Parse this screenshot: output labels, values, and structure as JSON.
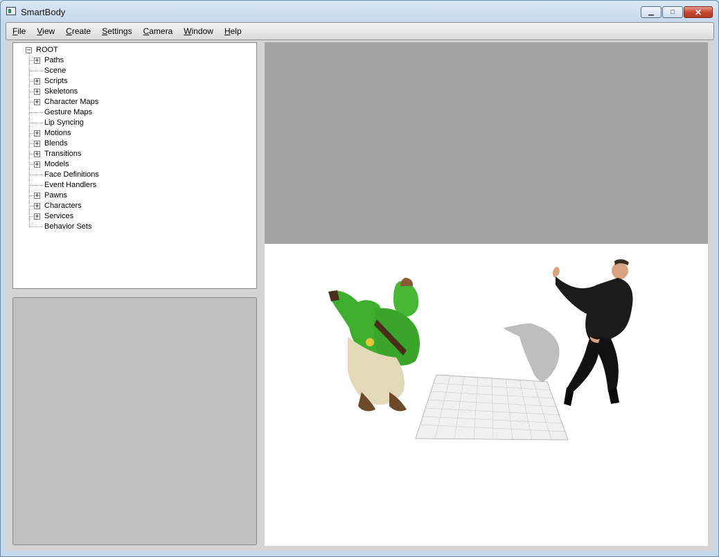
{
  "window": {
    "title": "SmartBody",
    "controls": {
      "minimize": "▁",
      "maximize": "□",
      "close": "✕"
    }
  },
  "menubar": {
    "items": [
      "File",
      "View",
      "Create",
      "Settings",
      "Camera",
      "Window",
      "Help"
    ]
  },
  "tree": {
    "root": {
      "label": "ROOT",
      "expanded": true
    },
    "items": [
      {
        "label": "Paths",
        "expandable": true
      },
      {
        "label": "Scene",
        "expandable": false
      },
      {
        "label": "Scripts",
        "expandable": true
      },
      {
        "label": "Skeletons",
        "expandable": true
      },
      {
        "label": "Character Maps",
        "expandable": true
      },
      {
        "label": "Gesture Maps",
        "expandable": false
      },
      {
        "label": "Lip Syncing",
        "expandable": false
      },
      {
        "label": "Motions",
        "expandable": true
      },
      {
        "label": "Blends",
        "expandable": true
      },
      {
        "label": "Transitions",
        "expandable": true
      },
      {
        "label": "Models",
        "expandable": true
      },
      {
        "label": "Face Definitions",
        "expandable": false
      },
      {
        "label": "Event Handlers",
        "expandable": false
      },
      {
        "label": "Pawns",
        "expandable": true
      },
      {
        "label": "Characters",
        "expandable": true
      },
      {
        "label": "Services",
        "expandable": true
      },
      {
        "label": "Behavior Sets",
        "expandable": false
      }
    ]
  },
  "viewport": {
    "characters": [
      {
        "name": "orc-character",
        "colors": {
          "skin": "#3fae2e",
          "pants": "#e3d8b8",
          "boots": "#6b4a2a",
          "straps": "#4a2e1c"
        }
      },
      {
        "name": "human-character",
        "colors": {
          "shirt": "#1b1b1b",
          "skin": "#d9a27f"
        }
      }
    ],
    "colors": {
      "sky": "#a3a3a3",
      "ground": "#ffffff",
      "grid": "#b8b8b8"
    }
  }
}
